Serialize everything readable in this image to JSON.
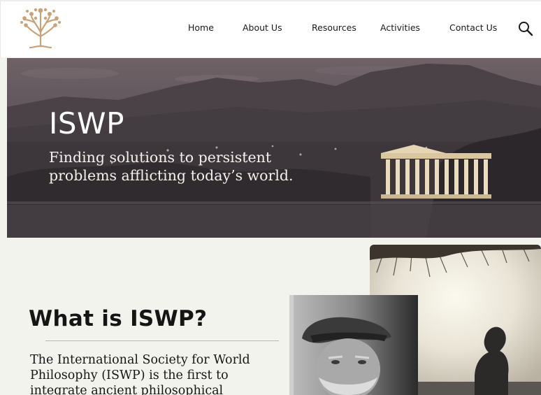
{
  "nav": {
    "items": [
      {
        "label": "Home"
      },
      {
        "label": "About Us"
      },
      {
        "label": "Resources"
      },
      {
        "label": "Activities"
      },
      {
        "label": "Contact Us"
      }
    ],
    "search_icon": "search-icon",
    "logo_icon": "tree-logo-icon"
  },
  "hero": {
    "title": "ISWP",
    "subtitle": "Finding solutions to persistent problems afflicting today’s world."
  },
  "about": {
    "heading": "What is ISWP?",
    "body": "The International Society for World Philosophy (ISWP) is the first to integrate ancient philosophical"
  },
  "colors": {
    "logo": "#c9a27a",
    "background": "#f3f3ee",
    "header": "#ffffff",
    "text": "#151515"
  }
}
